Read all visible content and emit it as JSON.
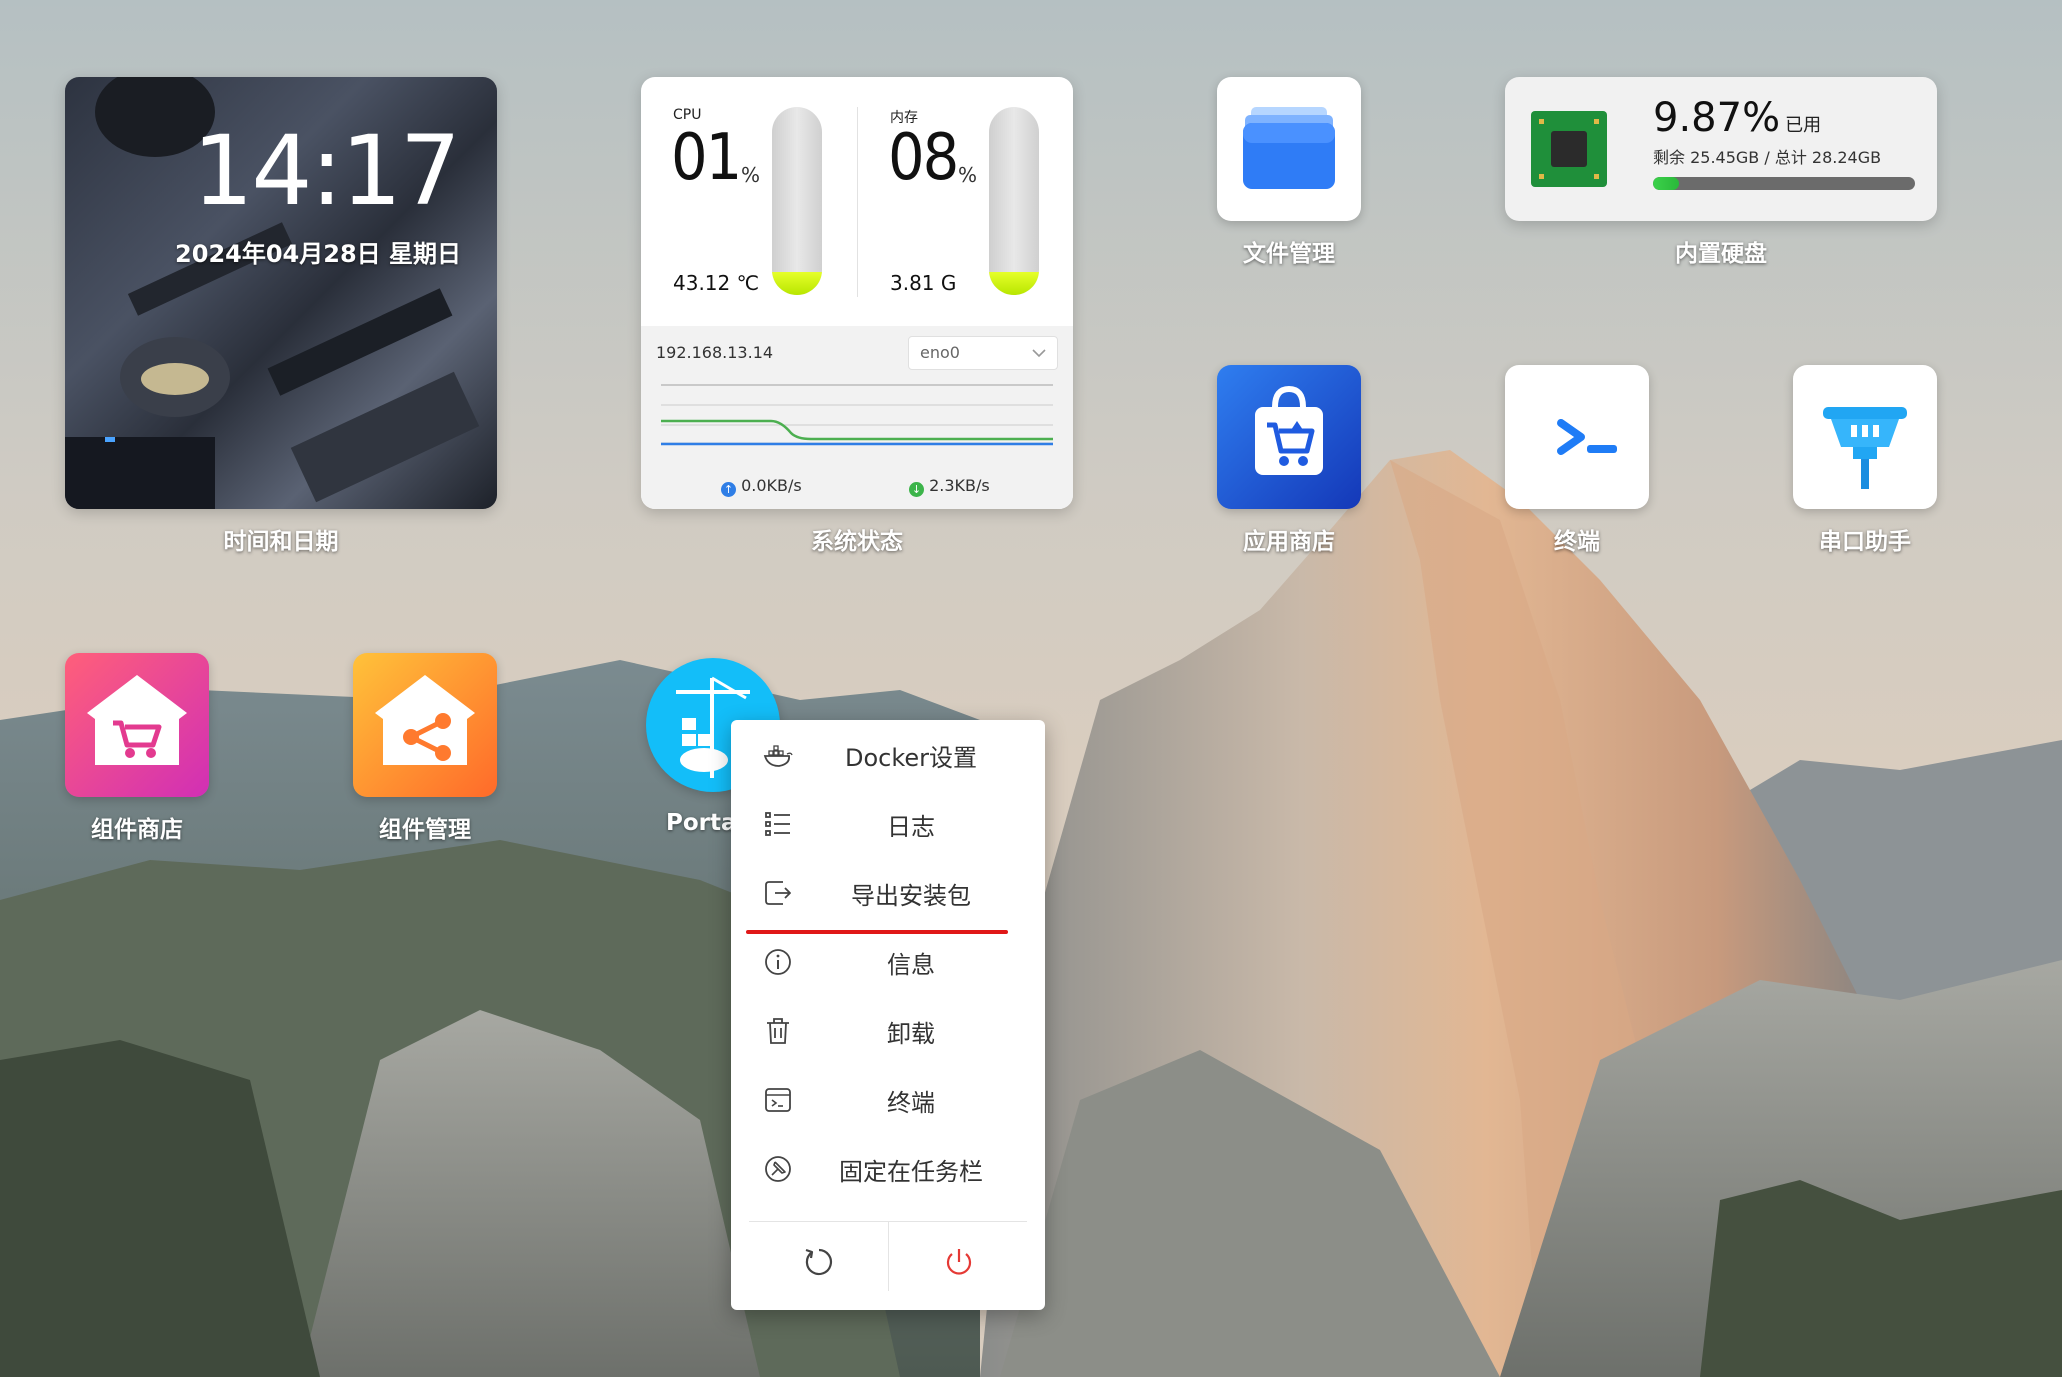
{
  "clock_widget": {
    "time": "14:17",
    "date": "2024年04月28日  星期日",
    "label": "时间和日期"
  },
  "system_status": {
    "label": "系统状态",
    "cpu": {
      "title": "CPU",
      "value": "01",
      "unit": "%",
      "temp": "43.12 ℃",
      "level": 0.12
    },
    "memory": {
      "title": "内存",
      "value": "08",
      "unit": "%",
      "used": "3.81 G",
      "level": 0.12
    },
    "network": {
      "ip": "192.168.13.14",
      "interface": "eno0",
      "upload": "0.0KB/s",
      "download": "2.3KB/s"
    }
  },
  "disk": {
    "label": "内置硬盘",
    "percent": "9.87%",
    "used_label": "已用",
    "detail": "剩余 25.45GB / 总计 28.24GB",
    "fill": 0.0987
  },
  "apps": {
    "file_manager": "文件管理",
    "app_store": "应用商店",
    "terminal": "终端",
    "serial_helper": "串口助手",
    "plugin_store": "组件商店",
    "plugin_manager": "组件管理",
    "portainer": "Portai"
  },
  "context_menu": {
    "items": [
      {
        "label": "Docker设置",
        "icon": "docker-icon"
      },
      {
        "label": "日志",
        "icon": "list-icon"
      },
      {
        "label": "导出安装包",
        "icon": "export-icon"
      },
      {
        "label": "信息",
        "icon": "info-icon"
      },
      {
        "label": "卸载",
        "icon": "trash-icon"
      },
      {
        "label": "终端",
        "icon": "terminal-icon"
      },
      {
        "label": "固定在任务栏",
        "icon": "pin-icon"
      }
    ],
    "restart_icon": "restart-icon",
    "power_icon": "power-icon",
    "power_color": "#e53935",
    "highlight_color": "#e01818"
  }
}
